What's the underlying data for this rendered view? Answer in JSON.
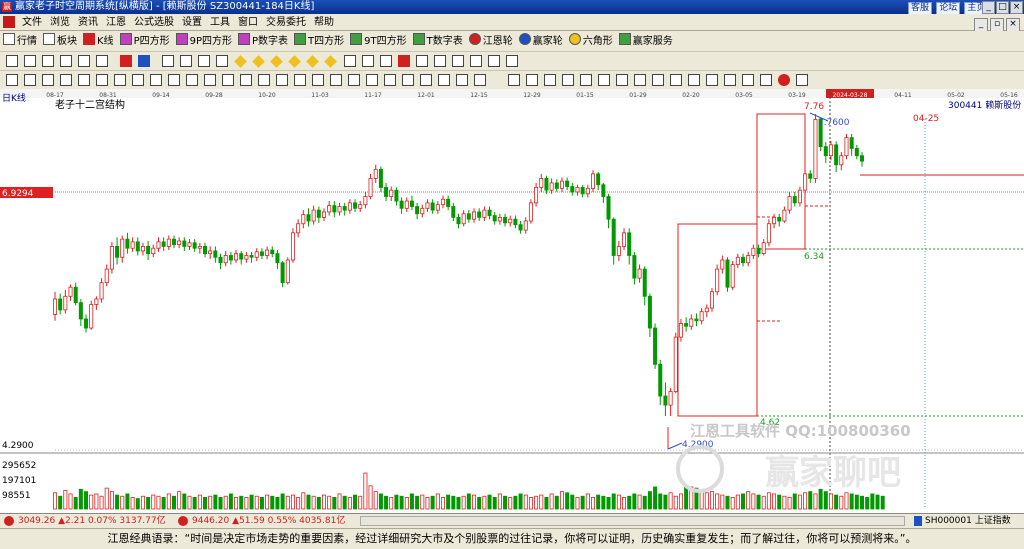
{
  "window": {
    "title": "赢家老子时空周期系统[纵横版] - [赖斯股份  SZ300441-184日K线]",
    "links": [
      "客服",
      "论坛",
      "主页"
    ]
  },
  "menu": [
    "文件",
    "浏览",
    "资讯",
    "江恩",
    "公式选股",
    "设置",
    "工具",
    "窗口",
    "交易委托",
    "帮助"
  ],
  "toolbar": [
    "行情",
    "板块",
    "K线",
    "P四方形",
    "9P四方形",
    "P数字表",
    "T四方形",
    "9T四方形",
    "T数字表",
    "江恩轮",
    "赢家轮",
    "六角形",
    "赢家服务"
  ],
  "chart_data": {
    "type": "candlestick",
    "period_label": "日K线",
    "title": "老子十二宫结构",
    "stock": "300441  赖斯股份",
    "date_ticks": [
      "08-17",
      "08-31",
      "09-14",
      "09-28",
      "10-20",
      "11-03",
      "11-17",
      "12-01",
      "12-15",
      "12-29",
      "01-15",
      "01-29",
      "02-20",
      "03-05",
      "03-19",
      "2024-03-28",
      "04-11",
      "05-02",
      "05-16"
    ],
    "price_labels": [
      "6.9294",
      "4.2900",
      "7.76",
      "7.7600",
      "6.34",
      "4.62",
      "4.2900",
      "04-25"
    ],
    "volume_labels": [
      "295652",
      "197101",
      "98551"
    ],
    "watermark": "江恩工具软件  QQ:100800360",
    "watermark2": "赢家聊吧",
    "ohlc": [
      {
        "o": 5.55,
        "c": 5.72,
        "h": 5.8,
        "l": 5.48
      },
      {
        "o": 5.72,
        "c": 5.6,
        "h": 5.78,
        "l": 5.55
      },
      {
        "o": 5.6,
        "c": 5.75,
        "h": 5.82,
        "l": 5.56
      },
      {
        "o": 5.75,
        "c": 5.85,
        "h": 5.88,
        "l": 5.7
      },
      {
        "o": 5.85,
        "c": 5.68,
        "h": 5.9,
        "l": 5.65
      },
      {
        "o": 5.68,
        "c": 5.5,
        "h": 5.72,
        "l": 5.42
      },
      {
        "o": 5.5,
        "c": 5.4,
        "h": 5.55,
        "l": 5.35
      },
      {
        "o": 5.4,
        "c": 5.66,
        "h": 5.7,
        "l": 5.38
      },
      {
        "o": 5.66,
        "c": 5.72,
        "h": 5.75,
        "l": 5.6
      },
      {
        "o": 5.72,
        "c": 5.9,
        "h": 5.95,
        "l": 5.68
      },
      {
        "o": 5.9,
        "c": 6.05,
        "h": 6.1,
        "l": 5.86
      },
      {
        "o": 6.05,
        "c": 6.3,
        "h": 6.35,
        "l": 6.0
      },
      {
        "o": 6.3,
        "c": 6.18,
        "h": 6.4,
        "l": 6.1
      },
      {
        "o": 6.18,
        "c": 6.38,
        "h": 6.42,
        "l": 6.12
      },
      {
        "o": 6.38,
        "c": 6.28,
        "h": 6.45,
        "l": 6.22
      },
      {
        "o": 6.28,
        "c": 6.35,
        "h": 6.4,
        "l": 6.24
      },
      {
        "o": 6.35,
        "c": 6.25,
        "h": 6.4,
        "l": 6.2
      },
      {
        "o": 6.25,
        "c": 6.3,
        "h": 6.34,
        "l": 6.2
      },
      {
        "o": 6.3,
        "c": 6.22,
        "h": 6.36,
        "l": 6.15
      },
      {
        "o": 6.22,
        "c": 6.28,
        "h": 6.32,
        "l": 6.18
      },
      {
        "o": 6.28,
        "c": 6.35,
        "h": 6.4,
        "l": 6.24
      },
      {
        "o": 6.35,
        "c": 6.3,
        "h": 6.4,
        "l": 6.25
      },
      {
        "o": 6.3,
        "c": 6.38,
        "h": 6.42,
        "l": 6.26
      },
      {
        "o": 6.38,
        "c": 6.32,
        "h": 6.42,
        "l": 6.28
      },
      {
        "o": 6.32,
        "c": 6.36,
        "h": 6.4,
        "l": 6.28
      },
      {
        "o": 6.36,
        "c": 6.3,
        "h": 6.4,
        "l": 6.25
      },
      {
        "o": 6.3,
        "c": 6.34,
        "h": 6.38,
        "l": 6.26
      },
      {
        "o": 6.34,
        "c": 6.28,
        "h": 6.38,
        "l": 6.24
      },
      {
        "o": 6.28,
        "c": 6.3,
        "h": 6.34,
        "l": 6.22
      },
      {
        "o": 6.3,
        "c": 6.22,
        "h": 6.34,
        "l": 6.18
      },
      {
        "o": 6.22,
        "c": 6.25,
        "h": 6.3,
        "l": 6.16
      },
      {
        "o": 6.25,
        "c": 6.18,
        "h": 6.3,
        "l": 6.12
      },
      {
        "o": 6.18,
        "c": 6.12,
        "h": 6.22,
        "l": 6.05
      },
      {
        "o": 6.12,
        "c": 6.2,
        "h": 6.25,
        "l": 6.08
      },
      {
        "o": 6.2,
        "c": 6.15,
        "h": 6.24,
        "l": 6.1
      },
      {
        "o": 6.15,
        "c": 6.22,
        "h": 6.26,
        "l": 6.12
      },
      {
        "o": 6.22,
        "c": 6.16,
        "h": 6.25,
        "l": 6.1
      },
      {
        "o": 6.16,
        "c": 6.2,
        "h": 6.24,
        "l": 6.12
      },
      {
        "o": 6.2,
        "c": 6.18,
        "h": 6.24,
        "l": 6.12
      },
      {
        "o": 6.18,
        "c": 6.24,
        "h": 6.28,
        "l": 6.14
      },
      {
        "o": 6.24,
        "c": 6.2,
        "h": 6.28,
        "l": 6.16
      },
      {
        "o": 6.2,
        "c": 6.26,
        "h": 6.3,
        "l": 6.16
      },
      {
        "o": 6.26,
        "c": 6.22,
        "h": 6.3,
        "l": 6.18
      },
      {
        "o": 6.22,
        "c": 6.12,
        "h": 6.26,
        "l": 6.05
      },
      {
        "o": 6.12,
        "c": 5.9,
        "h": 6.14,
        "l": 5.85
      },
      {
        "o": 5.9,
        "c": 6.15,
        "h": 6.18,
        "l": 5.88
      },
      {
        "o": 6.15,
        "c": 6.45,
        "h": 6.5,
        "l": 6.12
      },
      {
        "o": 6.45,
        "c": 6.55,
        "h": 6.6,
        "l": 6.4
      },
      {
        "o": 6.55,
        "c": 6.65,
        "h": 6.7,
        "l": 6.5
      },
      {
        "o": 6.65,
        "c": 6.58,
        "h": 6.72,
        "l": 6.52
      },
      {
        "o": 6.58,
        "c": 6.7,
        "h": 6.75,
        "l": 6.54
      },
      {
        "o": 6.7,
        "c": 6.62,
        "h": 6.74,
        "l": 6.56
      },
      {
        "o": 6.62,
        "c": 6.68,
        "h": 6.72,
        "l": 6.58
      },
      {
        "o": 6.68,
        "c": 6.75,
        "h": 6.8,
        "l": 6.64
      },
      {
        "o": 6.75,
        "c": 6.68,
        "h": 6.8,
        "l": 6.62
      },
      {
        "o": 6.68,
        "c": 6.74,
        "h": 6.78,
        "l": 6.64
      },
      {
        "o": 6.74,
        "c": 6.7,
        "h": 6.78,
        "l": 6.64
      },
      {
        "o": 6.7,
        "c": 6.78,
        "h": 6.82,
        "l": 6.66
      },
      {
        "o": 6.78,
        "c": 6.72,
        "h": 6.82,
        "l": 6.68
      },
      {
        "o": 6.72,
        "c": 6.76,
        "h": 6.8,
        "l": 6.68
      },
      {
        "o": 6.76,
        "c": 6.85,
        "h": 6.9,
        "l": 6.72
      },
      {
        "o": 6.85,
        "c": 7.05,
        "h": 7.1,
        "l": 6.82
      },
      {
        "o": 7.05,
        "c": 7.15,
        "h": 7.2,
        "l": 7.0
      },
      {
        "o": 7.15,
        "c": 6.95,
        "h": 7.18,
        "l": 6.9
      },
      {
        "o": 6.95,
        "c": 6.85,
        "h": 7.0,
        "l": 6.8
      },
      {
        "o": 6.85,
        "c": 6.92,
        "h": 6.96,
        "l": 6.8
      },
      {
        "o": 6.92,
        "c": 6.8,
        "h": 6.95,
        "l": 6.75
      },
      {
        "o": 6.8,
        "c": 6.72,
        "h": 6.84,
        "l": 6.66
      },
      {
        "o": 6.72,
        "c": 6.8,
        "h": 6.84,
        "l": 6.68
      },
      {
        "o": 6.8,
        "c": 6.74,
        "h": 6.86,
        "l": 6.7
      },
      {
        "o": 6.74,
        "c": 6.66,
        "h": 6.78,
        "l": 6.6
      },
      {
        "o": 6.66,
        "c": 6.72,
        "h": 6.76,
        "l": 6.62
      },
      {
        "o": 6.72,
        "c": 6.78,
        "h": 6.82,
        "l": 6.68
      },
      {
        "o": 6.78,
        "c": 6.7,
        "h": 6.82,
        "l": 6.66
      },
      {
        "o": 6.7,
        "c": 6.76,
        "h": 6.8,
        "l": 6.66
      },
      {
        "o": 6.76,
        "c": 6.82,
        "h": 6.86,
        "l": 6.72
      },
      {
        "o": 6.82,
        "c": 6.74,
        "h": 6.86,
        "l": 6.7
      },
      {
        "o": 6.74,
        "c": 6.62,
        "h": 6.78,
        "l": 6.58
      },
      {
        "o": 6.62,
        "c": 6.55,
        "h": 6.66,
        "l": 6.5
      },
      {
        "o": 6.55,
        "c": 6.66,
        "h": 6.7,
        "l": 6.52
      },
      {
        "o": 6.66,
        "c": 6.6,
        "h": 6.7,
        "l": 6.56
      },
      {
        "o": 6.6,
        "c": 6.68,
        "h": 6.72,
        "l": 6.56
      },
      {
        "o": 6.68,
        "c": 6.62,
        "h": 6.72,
        "l": 6.58
      },
      {
        "o": 6.62,
        "c": 6.7,
        "h": 6.74,
        "l": 6.58
      },
      {
        "o": 6.7,
        "c": 6.64,
        "h": 6.74,
        "l": 6.6
      },
      {
        "o": 6.64,
        "c": 6.58,
        "h": 6.68,
        "l": 6.54
      },
      {
        "o": 6.58,
        "c": 6.62,
        "h": 6.66,
        "l": 6.54
      },
      {
        "o": 6.62,
        "c": 6.56,
        "h": 6.66,
        "l": 6.52
      },
      {
        "o": 6.56,
        "c": 6.6,
        "h": 6.64,
        "l": 6.52
      },
      {
        "o": 6.6,
        "c": 6.54,
        "h": 6.64,
        "l": 6.5
      },
      {
        "o": 6.54,
        "c": 6.48,
        "h": 6.58,
        "l": 6.44
      },
      {
        "o": 6.48,
        "c": 6.58,
        "h": 6.62,
        "l": 6.44
      },
      {
        "o": 6.58,
        "c": 6.78,
        "h": 6.82,
        "l": 6.55
      },
      {
        "o": 6.78,
        "c": 6.95,
        "h": 7.0,
        "l": 6.74
      },
      {
        "o": 6.95,
        "c": 7.05,
        "h": 7.1,
        "l": 6.9
      },
      {
        "o": 7.05,
        "c": 6.92,
        "h": 7.08,
        "l": 6.88
      },
      {
        "o": 6.92,
        "c": 7.0,
        "h": 7.05,
        "l": 6.88
      },
      {
        "o": 7.0,
        "c": 6.94,
        "h": 7.04,
        "l": 6.9
      },
      {
        "o": 6.94,
        "c": 7.02,
        "h": 7.06,
        "l": 6.9
      },
      {
        "o": 7.02,
        "c": 6.96,
        "h": 7.06,
        "l": 6.92
      },
      {
        "o": 6.96,
        "c": 6.9,
        "h": 7.0,
        "l": 6.86
      },
      {
        "o": 6.9,
        "c": 6.95,
        "h": 6.98,
        "l": 6.86
      },
      {
        "o": 6.95,
        "c": 6.88,
        "h": 6.98,
        "l": 6.84
      },
      {
        "o": 6.88,
        "c": 6.94,
        "h": 6.98,
        "l": 6.84
      },
      {
        "o": 6.94,
        "c": 7.1,
        "h": 7.14,
        "l": 6.9
      },
      {
        "o": 7.1,
        "c": 6.98,
        "h": 7.12,
        "l": 6.92
      },
      {
        "o": 6.98,
        "c": 6.85,
        "h": 7.0,
        "l": 6.78
      },
      {
        "o": 6.85,
        "c": 6.6,
        "h": 6.88,
        "l": 6.5
      },
      {
        "o": 6.6,
        "c": 6.2,
        "h": 6.62,
        "l": 6.1
      },
      {
        "o": 6.2,
        "c": 6.3,
        "h": 6.36,
        "l": 6.14
      },
      {
        "o": 6.3,
        "c": 6.45,
        "h": 6.5,
        "l": 6.26
      },
      {
        "o": 6.45,
        "c": 6.2,
        "h": 6.5,
        "l": 6.1
      },
      {
        "o": 6.2,
        "c": 5.95,
        "h": 6.24,
        "l": 5.88
      },
      {
        "o": 5.95,
        "c": 6.05,
        "h": 6.1,
        "l": 5.9
      },
      {
        "o": 6.05,
        "c": 5.75,
        "h": 6.08,
        "l": 5.65
      },
      {
        "o": 5.75,
        "c": 5.4,
        "h": 5.78,
        "l": 5.3
      },
      {
        "o": 5.4,
        "c": 5.0,
        "h": 5.45,
        "l": 4.95
      },
      {
        "o": 5.0,
        "c": 4.65,
        "h": 5.05,
        "l": 4.55
      },
      {
        "o": 4.65,
        "c": 4.55,
        "h": 4.8,
        "l": 4.43
      },
      {
        "o": 4.55,
        "c": 4.7,
        "h": 4.74,
        "l": 4.43
      },
      {
        "o": 4.7,
        "c": 5.3,
        "h": 5.35,
        "l": 4.68
      },
      {
        "o": 5.3,
        "c": 5.45,
        "h": 5.5,
        "l": 5.25
      },
      {
        "o": 5.45,
        "c": 5.42,
        "h": 5.52,
        "l": 5.36
      },
      {
        "o": 5.42,
        "c": 5.5,
        "h": 5.55,
        "l": 5.38
      },
      {
        "o": 5.5,
        "c": 5.48,
        "h": 5.56,
        "l": 5.42
      },
      {
        "o": 5.48,
        "c": 5.58,
        "h": 5.62,
        "l": 5.44
      },
      {
        "o": 5.58,
        "c": 5.62,
        "h": 5.66,
        "l": 5.52
      },
      {
        "o": 5.62,
        "c": 5.8,
        "h": 5.84,
        "l": 5.58
      },
      {
        "o": 5.8,
        "c": 6.05,
        "h": 6.1,
        "l": 5.76
      },
      {
        "o": 6.05,
        "c": 6.15,
        "h": 6.2,
        "l": 6.0
      },
      {
        "o": 6.15,
        "c": 5.85,
        "h": 6.18,
        "l": 5.8
      },
      {
        "o": 5.85,
        "c": 6.1,
        "h": 6.14,
        "l": 5.82
      },
      {
        "o": 6.1,
        "c": 6.18,
        "h": 6.22,
        "l": 6.06
      },
      {
        "o": 6.18,
        "c": 6.12,
        "h": 6.22,
        "l": 6.08
      },
      {
        "o": 6.12,
        "c": 6.2,
        "h": 6.24,
        "l": 6.08
      },
      {
        "o": 6.2,
        "c": 6.28,
        "h": 6.32,
        "l": 6.16
      },
      {
        "o": 6.28,
        "c": 6.22,
        "h": 6.32,
        "l": 6.18
      },
      {
        "o": 6.22,
        "c": 6.34,
        "h": 6.38,
        "l": 6.2
      },
      {
        "o": 6.34,
        "c": 6.55,
        "h": 6.6,
        "l": 6.3
      },
      {
        "o": 6.55,
        "c": 6.62,
        "h": 6.66,
        "l": 6.5
      },
      {
        "o": 6.62,
        "c": 6.58,
        "h": 6.66,
        "l": 6.52
      },
      {
        "o": 6.58,
        "c": 6.7,
        "h": 6.74,
        "l": 6.56
      },
      {
        "o": 6.7,
        "c": 6.85,
        "h": 6.9,
        "l": 6.66
      },
      {
        "o": 6.85,
        "c": 6.78,
        "h": 6.9,
        "l": 6.74
      },
      {
        "o": 6.78,
        "c": 6.92,
        "h": 6.96,
        "l": 6.74
      },
      {
        "o": 6.92,
        "c": 7.1,
        "h": 7.15,
        "l": 6.88
      },
      {
        "o": 7.1,
        "c": 7.05,
        "h": 7.14,
        "l": 7.0
      },
      {
        "o": 7.05,
        "c": 7.7,
        "h": 7.76,
        "l": 7.0
      },
      {
        "o": 7.7,
        "c": 7.4,
        "h": 7.72,
        "l": 7.35
      },
      {
        "o": 7.4,
        "c": 7.3,
        "h": 7.45,
        "l": 7.22
      },
      {
        "o": 7.3,
        "c": 7.42,
        "h": 7.46,
        "l": 7.25
      },
      {
        "o": 7.42,
        "c": 7.2,
        "h": 7.46,
        "l": 7.12
      },
      {
        "o": 7.2,
        "c": 7.3,
        "h": 7.34,
        "l": 7.14
      },
      {
        "o": 7.3,
        "c": 7.5,
        "h": 7.54,
        "l": 7.26
      },
      {
        "o": 7.5,
        "c": 7.38,
        "h": 7.54,
        "l": 7.3
      },
      {
        "o": 7.38,
        "c": 7.3,
        "h": 7.42,
        "l": 7.26
      },
      {
        "o": 7.3,
        "c": 7.24,
        "h": 7.34,
        "l": 7.18
      }
    ],
    "volume": [
      28,
      22,
      32,
      26,
      20,
      34,
      30,
      24,
      26,
      22,
      36,
      30,
      24,
      22,
      26,
      20,
      18,
      22,
      20,
      24,
      22,
      20,
      26,
      22,
      30,
      26,
      22,
      20,
      24,
      20,
      22,
      24,
      20,
      22,
      26,
      20,
      22,
      20,
      24,
      22,
      20,
      24,
      22,
      20,
      26,
      22,
      24,
      20,
      28,
      24,
      22,
      20,
      24,
      22,
      20,
      26,
      22,
      20,
      24,
      22,
      62,
      40,
      30,
      26,
      22,
      20,
      24,
      22,
      20,
      26,
      22,
      24,
      20,
      22,
      26,
      20,
      24,
      22,
      20,
      22,
      26,
      24,
      20,
      22,
      24,
      20,
      26,
      22,
      20,
      22,
      26,
      24,
      20,
      22,
      24,
      20,
      26,
      22,
      30,
      28,
      24,
      20,
      22,
      26,
      20,
      24,
      22,
      20,
      26,
      24,
      20,
      22,
      26,
      24,
      22,
      30,
      38,
      26,
      24,
      28,
      22,
      26,
      40,
      38,
      36,
      32,
      28,
      30,
      26,
      24,
      22,
      20,
      24,
      26,
      30,
      26,
      24,
      22,
      28,
      26,
      24,
      22,
      20,
      26,
      24,
      28,
      30,
      26,
      34,
      30,
      26,
      24,
      22,
      28,
      26,
      24,
      22,
      20,
      26,
      24,
      22
    ],
    "vol_max": 100
  },
  "status": {
    "sh": "3049.26",
    "sh_chg": "▲2.21",
    "sh_pct": "0.07%",
    "sh_amt": "3137.77亿",
    "sz": "9446.20",
    "sz_chg": "▲51.59",
    "sz_pct": "0.55%",
    "sz_amt": "4035.81亿",
    "code": "SH000001 上证指数"
  },
  "quote": "江恩经典语录：“时间是决定市场走势的重要因素，经过详细研究大市及个别股票的过往记录，你将可以证明，历史确实重复发生；而了解过往，你将可以预测将来。”。"
}
